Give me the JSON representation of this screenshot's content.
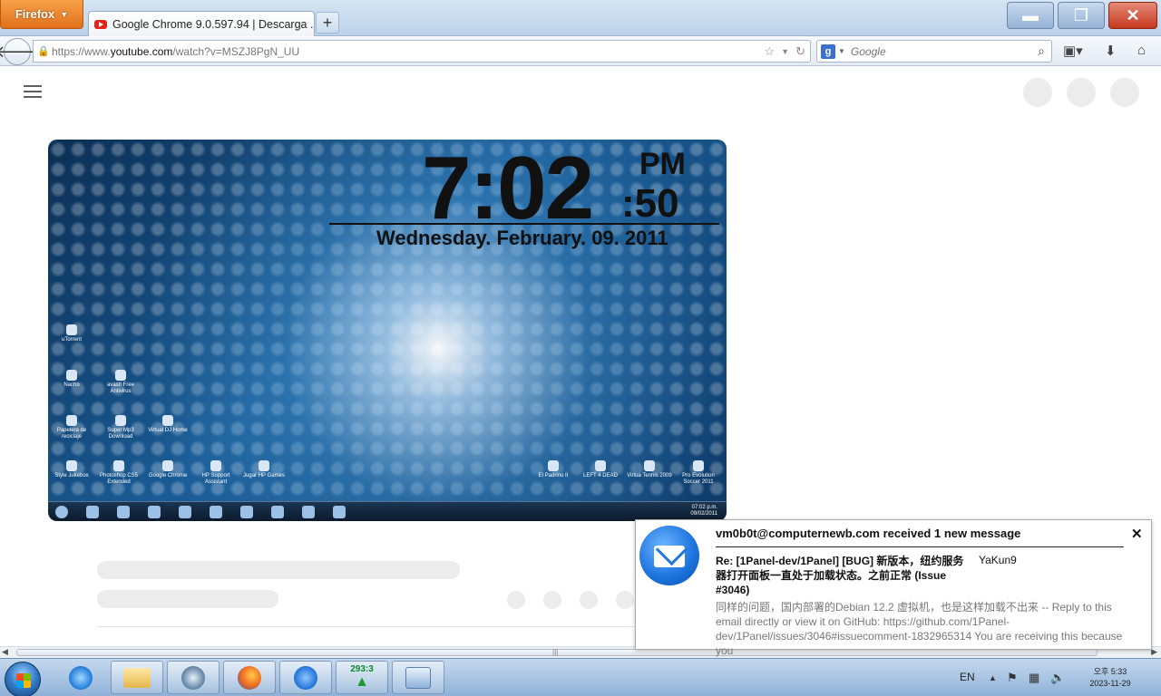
{
  "browser": {
    "menu_label": "Firefox",
    "tab_title": "Google Chrome 9.0.597.94 | Descarga ...",
    "new_tab_symbol": "+",
    "window_controls": {
      "minimize": "▬",
      "restore": "❐",
      "close": "✕"
    },
    "url_prefix": "https://www.",
    "url_host": "youtube.com",
    "url_path": "/watch?v=MSZJ8PgN_UU",
    "search_placeholder": "Google",
    "icons": [
      "back-arrow-icon",
      "lock-icon",
      "bookmark-star-icon",
      "dropdown-icon",
      "reload-icon",
      "google-search-icon",
      "magnifier-icon",
      "bookmarks-icon",
      "download-icon",
      "home-icon"
    ]
  },
  "video": {
    "clock_time": "7:02",
    "clock_ampm": "PM",
    "clock_seconds": ":50",
    "clock_date": "Wednesday. February. 09. 2011",
    "desktop_icons": [
      {
        "label": "uTorrent"
      },
      {
        "label": "Nacho"
      },
      {
        "label": "avast! Free Antivirus"
      },
      {
        "label": "Papelera de reciclaje"
      },
      {
        "label": "Super Mp3 Download"
      },
      {
        "label": "Virtual DJ Home"
      },
      {
        "label": "Style Jukebox"
      },
      {
        "label": "Photoshop CS5 Extended"
      },
      {
        "label": "Google Chrome"
      },
      {
        "label": "HP Support Assistant"
      },
      {
        "label": "Jugar HP Games"
      },
      {
        "label": "El Padrino II"
      },
      {
        "label": "LEFT 4 DEAD"
      },
      {
        "label": "Virtua Tennis 2009"
      },
      {
        "label": "Pro Evolution Soccer 2011"
      }
    ],
    "tray_time": "07:02 p.m.",
    "tray_date": "09/02/2011"
  },
  "notification": {
    "header": "vm0b0t@computernewb.com received 1 new message",
    "subject": "Re: [1Panel-dev/1Panel] [BUG] 新版本，纽约服务器打开面板一直处于加载状态。之前正常 (Issue #3046)",
    "sender": "YaKun9",
    "body": "同样的问题，国内部署的Debian 12.2 虚拟机，也是这样加载不出来 -- Reply to this email directly or view it on GitHub: https://github.com/1Panel-dev/1Panel/issues/3046#issuecomment-1832965314 You are receiving this because you",
    "close_symbol": "✕"
  },
  "taskbar": {
    "apps": [
      "internet-explorer-icon",
      "file-explorer-icon",
      "media-center-icon",
      "firefox-icon",
      "thunderbird-icon",
      "counter-tree-icon",
      "control-panel-icon"
    ],
    "counter_label": "293:3",
    "language": "EN",
    "clock_line1": "오후 5:33",
    "clock_line2": "2023-11-29"
  }
}
